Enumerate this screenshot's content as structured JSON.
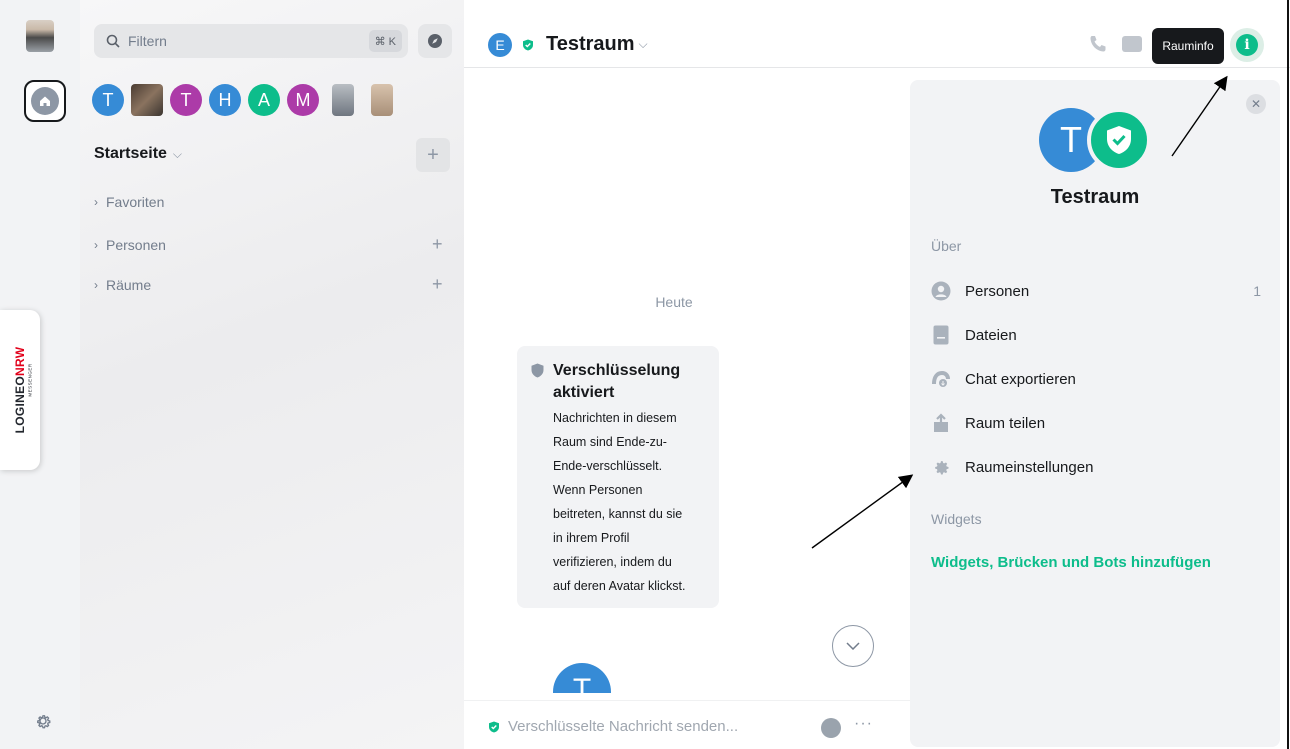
{
  "sidebar": {
    "brand": {
      "logo_main": "LOGINEO",
      "logo_accent": "NRW",
      "logo_sub": "MESSENGER"
    }
  },
  "room_list": {
    "filter_placeholder": "Filtern",
    "filter_shortcut": "⌘ K",
    "recents": [
      {
        "letter": "T",
        "color": "#368bd6"
      },
      {
        "letter": "",
        "color": "#6b5a4c"
      },
      {
        "letter": "T",
        "color": "#ac3ba8"
      },
      {
        "letter": "H",
        "color": "#368bd6"
      },
      {
        "letter": "A",
        "color": "#0dbd8b"
      },
      {
        "letter": "M",
        "color": "#ac3ba8"
      },
      {
        "letter": "",
        "color": "#9fa6ad"
      },
      {
        "letter": "",
        "color": "#c7b299"
      }
    ],
    "home_title": "Startseite",
    "sections": [
      {
        "label": "Favoriten"
      },
      {
        "label": "Personen"
      },
      {
        "label": "Räume"
      }
    ]
  },
  "room_header": {
    "avatar_letter": "E",
    "room_name": "Testraum",
    "tooltip": "Rauminfo"
  },
  "timeline": {
    "date_separator": "Heute",
    "encryption": {
      "title_line1": "Verschlüsselung",
      "title_line2": "aktiviert",
      "body_lines": [
        "Nachrichten in diesem",
        "Raum sind Ende-zu-",
        "Ende-verschlüsselt.",
        "Wenn Personen",
        "beitreten, kannst du sie",
        "in ihrem Profil",
        "verifizieren, indem du",
        "auf deren Avatar klickst."
      ]
    },
    "message_avatar_letter": "T"
  },
  "composer": {
    "placeholder": "Verschlüsselte Nachricht senden..."
  },
  "room_info": {
    "avatar_letter": "T",
    "room_name": "Testraum",
    "about_heading": "Über",
    "items": [
      {
        "label": "Personen",
        "count": "1",
        "icon": "person-icon"
      },
      {
        "label": "Dateien",
        "count": "",
        "icon": "file-icon"
      },
      {
        "label": "Chat exportieren",
        "count": "",
        "icon": "export-icon"
      },
      {
        "label": "Raum teilen",
        "count": "",
        "icon": "share-icon"
      },
      {
        "label": "Raumeinstellungen",
        "count": "",
        "icon": "gear-icon"
      }
    ],
    "widgets_heading": "Widgets",
    "widgets_link": "Widgets, Brücken und Bots hinzufügen"
  },
  "colors": {
    "accent": "#0dbd8b",
    "avatar_blue": "#368bd6",
    "avatar_purple": "#ac3ba8",
    "muted": "#8d97a5"
  }
}
